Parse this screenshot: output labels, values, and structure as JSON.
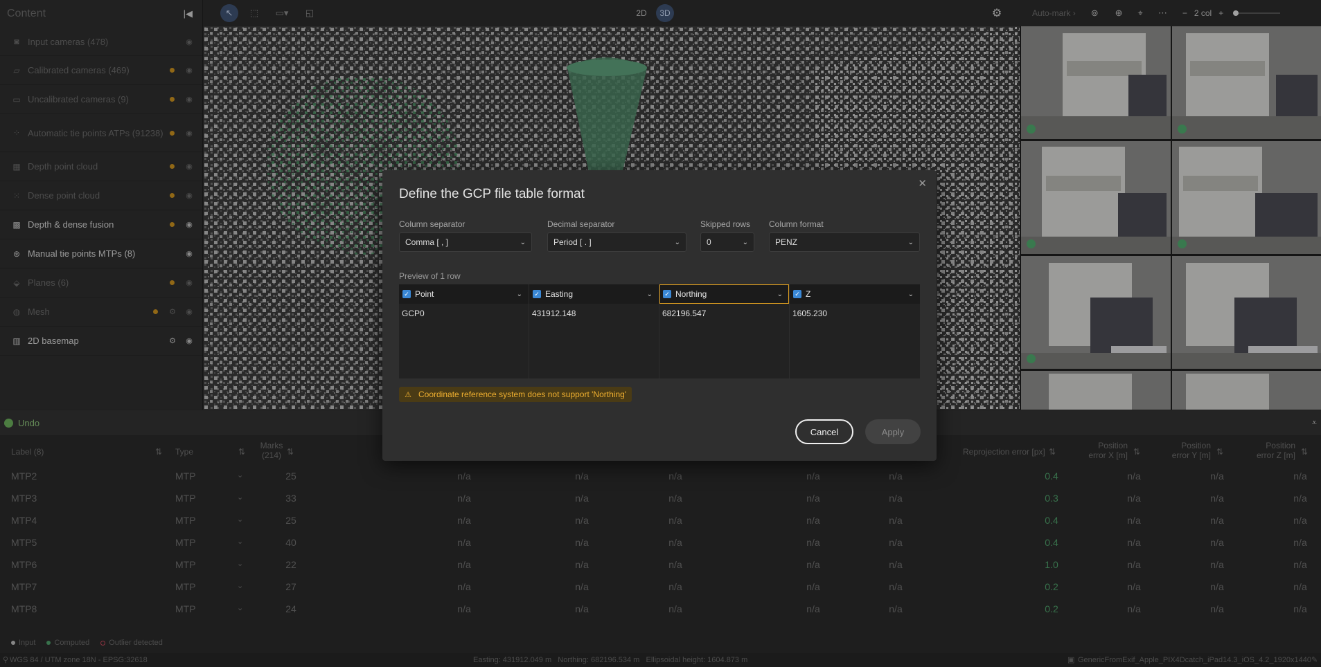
{
  "sidebar": {
    "title": "Content",
    "items": [
      {
        "label": "Input cameras (478)",
        "icon": "camera-icon",
        "dot": false,
        "active": false
      },
      {
        "label": "Calibrated cameras (469)",
        "icon": "calibrated-camera-icon",
        "dot": true,
        "active": false
      },
      {
        "label": "Uncalibrated cameras (9)",
        "icon": "uncalibrated-camera-icon",
        "dot": true,
        "active": false
      },
      {
        "label": "Automatic tie points ATPs (91238)",
        "icon": "tie-points-icon",
        "dot": true,
        "active": false
      },
      {
        "label": "Depth point cloud",
        "icon": "depth-cloud-icon",
        "dot": true,
        "active": false
      },
      {
        "label": "Dense point cloud",
        "icon": "dense-cloud-icon",
        "dot": true,
        "active": false
      },
      {
        "label": "Depth & dense fusion",
        "icon": "fusion-icon",
        "dot": true,
        "active": true
      },
      {
        "label": "Manual tie points MTPs (8)",
        "icon": "manual-tie-points-icon",
        "dot": false,
        "active": true
      },
      {
        "label": "Planes (6)",
        "icon": "planes-icon",
        "dot": true,
        "active": false
      },
      {
        "label": "Mesh",
        "icon": "mesh-icon",
        "dot": true,
        "active": false
      },
      {
        "label": "2D basemap",
        "icon": "map-icon",
        "dot": false,
        "active": true
      }
    ]
  },
  "toolbar": {
    "mode_2d": "2D",
    "mode_3d": "3D"
  },
  "right_panel": {
    "automark": "Auto-mark",
    "columns": "2 col"
  },
  "undo": "Undo",
  "table": {
    "headers": {
      "label": "Label (8)",
      "type": "Type",
      "marks": "Marks (214)",
      "reprojection": "Reprojection error [px]",
      "pos_x": "Position error X [m]",
      "pos_y": "Position error Y [m]",
      "pos_z": "Position error Z [m]"
    },
    "rows": [
      {
        "label": "MTP2",
        "type": "MTP",
        "marks": "25",
        "reproj": "0.4"
      },
      {
        "label": "MTP3",
        "type": "MTP",
        "marks": "33",
        "reproj": "0.3"
      },
      {
        "label": "MTP4",
        "type": "MTP",
        "marks": "25",
        "reproj": "0.4"
      },
      {
        "label": "MTP5",
        "type": "MTP",
        "marks": "40",
        "reproj": "0.4"
      },
      {
        "label": "MTP6",
        "type": "MTP",
        "marks": "22",
        "reproj": "1.0"
      },
      {
        "label": "MTP7",
        "type": "MTP",
        "marks": "27",
        "reproj": "0.2"
      },
      {
        "label": "MTP8",
        "type": "MTP",
        "marks": "24",
        "reproj": "0.2"
      }
    ],
    "na": "n/a"
  },
  "legend": {
    "input": "Input",
    "computed": "Computed",
    "outlier": "Outlier detected"
  },
  "status": {
    "crs": "WGS 84 / UTM zone 18N - EPSG:32618",
    "coords": "Easting: 431912.049 m   Northing: 682196.534 m   Ellipsoidal height: 1604.873 m",
    "camera": "GenericFromExif_Apple_PIX4Dcatch_iPad14.3_iOS_4.2_1920x1440"
  },
  "dialog": {
    "title": "Define the GCP file table format",
    "column_separator_label": "Column separator",
    "column_separator_value": "Comma [ , ]",
    "decimal_separator_label": "Decimal separator",
    "decimal_separator_value": "Period [ . ]",
    "skipped_rows_label": "Skipped rows",
    "skipped_rows_value": "0",
    "column_format_label": "Column format",
    "column_format_value": "PENZ",
    "preview_label": "Preview of 1 row",
    "columns": [
      {
        "name": "Point",
        "value": "GCP0"
      },
      {
        "name": "Easting",
        "value": "431912.148"
      },
      {
        "name": "Northing",
        "value": "682196.547"
      },
      {
        "name": "Z",
        "value": "1605.230"
      }
    ],
    "warning": "Coordinate reference system does not support 'Northing'",
    "cancel": "Cancel",
    "apply": "Apply"
  },
  "colors": {
    "accent_blue": "#3a88d6",
    "warning": "#f0b030",
    "green": "#4e9f6a",
    "orange_dot": "#c9901f"
  }
}
